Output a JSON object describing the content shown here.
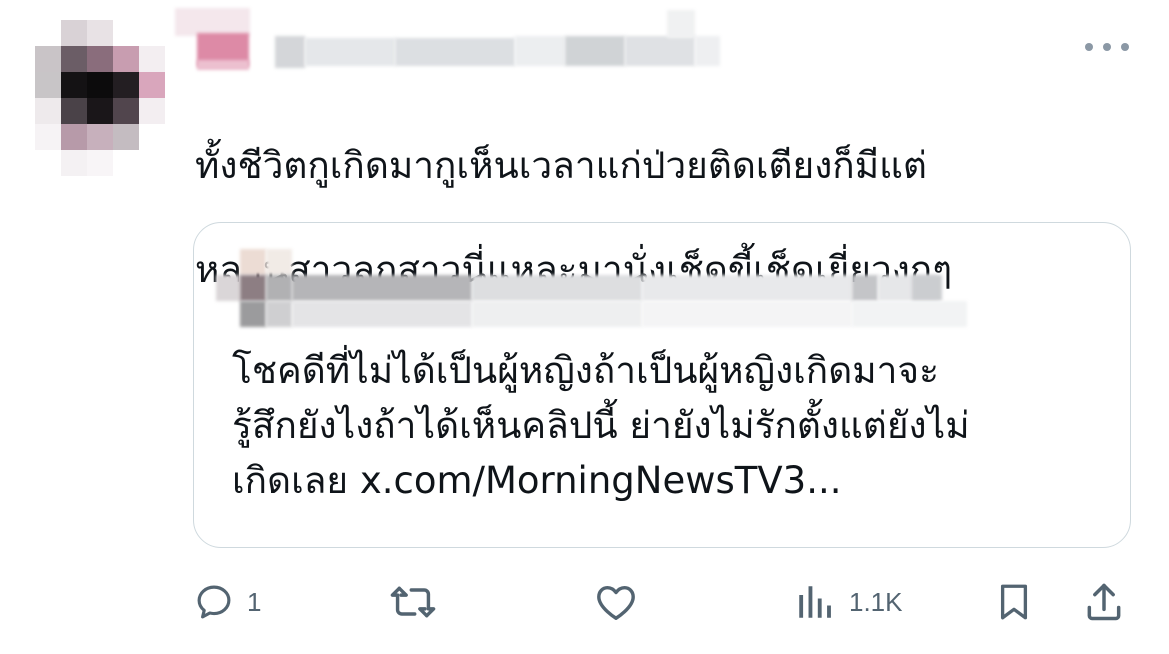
{
  "tweet": {
    "text_line1": "ทั้งชีวิตกูเกิดมากูเห็นเวลาแก่ป่วยติดเตียงก็มีแต่",
    "text_line2": "หลานสาวลูกสาวนี่แหละมานั่งเช็ดขี้เช็ดเยี่ยวงกๆ"
  },
  "quote": {
    "text_line1": "โชคดีที่ไม่ได้เป็นผู้หญิงถ้าเป็นผู้หญิงเกิดมาจะ",
    "text_line2": "รู้สึกยังไงถ้าได้เห็นคลิปนี้ ย่ายังไม่รักตั้งแต่ยังไม่",
    "text_line3": "เกิดเลย x.com/MorningNewsTV3..."
  },
  "actions": {
    "reply_count": "1",
    "views_count": "1.1K"
  },
  "icons": {
    "more": "more-horizontal-icon",
    "reply": "reply-icon",
    "retweet": "retweet-icon",
    "like": "like-icon",
    "views": "views-icon",
    "bookmark": "bookmark-icon",
    "share": "share-icon"
  },
  "colors": {
    "text": "#0f1419",
    "secondary": "#536471",
    "border": "#cfd9de"
  }
}
